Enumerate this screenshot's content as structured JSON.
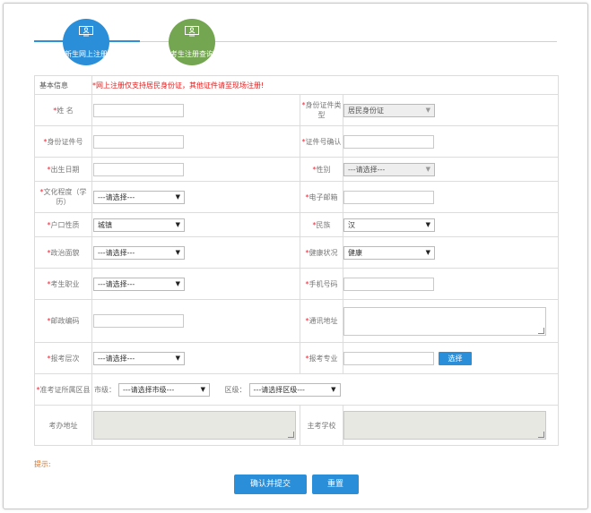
{
  "steps": [
    {
      "label": "新生网上注册",
      "icon": "monitor-user-icon",
      "color": "#2a8ed8"
    },
    {
      "label": "考生注册查询",
      "icon": "monitor-user-icon",
      "color": "#74a550"
    }
  ],
  "form": {
    "section_title": "基本信息",
    "notice": "*网上注册仅支持居民身份证，其他证件请至现场注册!",
    "fields": {
      "name": {
        "label": "姓    名",
        "value": ""
      },
      "id_type": {
        "label": "身份证件类型",
        "value": "居民身份证"
      },
      "id_number": {
        "label": "身份证件号",
        "value": ""
      },
      "id_confirm": {
        "label": "证件号确认",
        "value": ""
      },
      "birth_date": {
        "label": "出生日期",
        "value": ""
      },
      "gender": {
        "label": "性别",
        "value": "---请选择---"
      },
      "education": {
        "label": "文化程度（学历）",
        "value": "---请选择---"
      },
      "email": {
        "label": "电子邮箱",
        "value": ""
      },
      "household": {
        "label": "户口性质",
        "value": "城镇"
      },
      "ethnicity": {
        "label": "民族",
        "value": "汉"
      },
      "political": {
        "label": "政治面貌",
        "value": "---请选择---"
      },
      "health": {
        "label": "健康状况",
        "value": "健康"
      },
      "occupation": {
        "label": "考生职业",
        "value": "---请选择---"
      },
      "phone": {
        "label": "手机号码",
        "value": ""
      },
      "postcode": {
        "label": "邮政编码",
        "value": ""
      },
      "address": {
        "label": "通讯地址",
        "value": ""
      },
      "level": {
        "label": "报考层次",
        "value": "---请选择---"
      },
      "major": {
        "label": "报考专业",
        "value": "",
        "button": "选择"
      },
      "region": {
        "label": "准考证所属区县",
        "city_label": "市级：",
        "city_value": "---请选择市级---",
        "district_label": "区级：",
        "district_value": "---请选择区级---"
      },
      "exam_office": {
        "label": "考办地址",
        "value": ""
      },
      "school": {
        "label": "主考学校",
        "value": ""
      }
    },
    "required_mark": "*"
  },
  "hint": "提示:",
  "buttons": {
    "submit": "确认并提交",
    "reset": "重置"
  },
  "colors": {
    "primary": "#2a8ed8",
    "secondary": "#74a550",
    "required": "#e02020",
    "hint": "#e07020"
  }
}
